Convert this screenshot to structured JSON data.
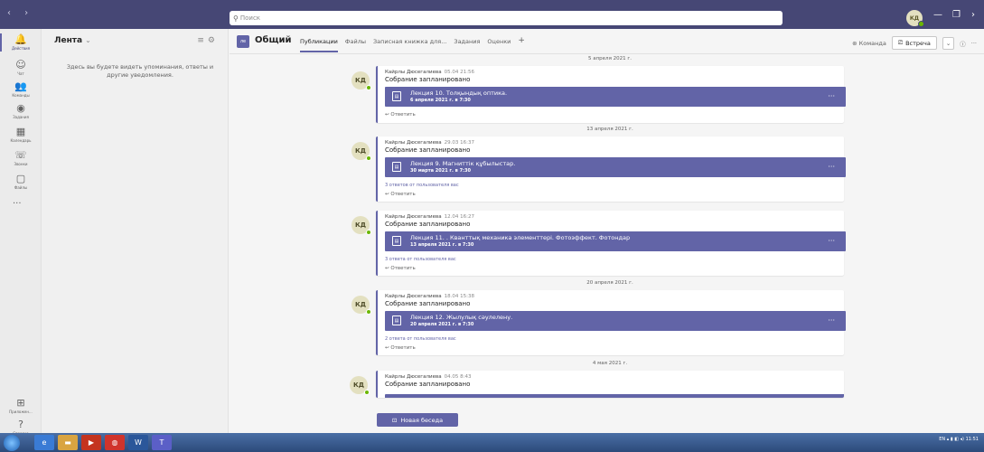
{
  "titlebar": {
    "nav_arrows": "‹ ›",
    "search_placeholder": "Поиск",
    "avatar_initials": "КД"
  },
  "rail": {
    "items": [
      {
        "label": "Действия",
        "icon": "bell-icon",
        "glyph": "🔔"
      },
      {
        "label": "Чат",
        "icon": "chat-icon",
        "glyph": "☺"
      },
      {
        "label": "Команды",
        "icon": "teams-icon",
        "glyph": "👥"
      },
      {
        "label": "Задания",
        "icon": "assignments-icon",
        "glyph": "◉"
      },
      {
        "label": "Календарь",
        "icon": "calendar-icon",
        "glyph": "▦"
      },
      {
        "label": "Звонки",
        "icon": "phone-icon",
        "glyph": "☏"
      },
      {
        "label": "Файлы",
        "icon": "files-icon",
        "glyph": "▢"
      }
    ],
    "more": "···",
    "bottom": [
      {
        "label": "Приложен...",
        "icon": "apps-icon",
        "glyph": "⊞"
      },
      {
        "label": "Справка",
        "icon": "help-icon",
        "glyph": "?"
      }
    ]
  },
  "feed": {
    "title": "Лента",
    "empty_text": "Здесь вы будете видеть упоминания, ответы и другие уведомления."
  },
  "channel": {
    "team_badge": "ле",
    "name": "Общий",
    "tabs": [
      "Публикации",
      "Файлы",
      "Записная книжка для...",
      "Задания",
      "Оценки"
    ],
    "team_btn": "Команда",
    "meet_btn": "Встреча"
  },
  "posts": [
    {
      "date": "5 апреля 2021 г.",
      "author": "Кайрлы Дюсегалиева",
      "time": "05.04 21:56",
      "text": "Собрание запланировано",
      "meeting_title": "Лекция 10. Толқындық оптика.",
      "meeting_date": "6 апреля 2021 г. в 7:30",
      "replies": "",
      "reply": "Ответить"
    },
    {
      "date": "13 апреля 2021 г.",
      "author": "Кайрлы Дюсегалиева",
      "time": "29.03 16:37",
      "text": "Собрание запланировано",
      "meeting_title": "Лекция 9. Магниттік құбылыстар.",
      "meeting_date": "30 марта 2021 г. в 7:30",
      "replies": "3 ответов от пользователя вас",
      "reply": "Ответить"
    },
    {
      "date": "",
      "author": "Кайрлы Дюсегалиева",
      "time": "12.04 16:27",
      "text": "Собрание запланировано",
      "meeting_title": "Лекция 11. . Кванттық механика элементтері. Фотоэффект. Фотондар",
      "meeting_date": "13 апреля 2021 г. в 7:30",
      "replies": "3 ответа от пользователя вас",
      "reply": "Ответить"
    },
    {
      "date": "20 апреля 2021 г.",
      "author": "Кайрлы Дюсегалиева",
      "time": "18.04 15:38",
      "text": "Собрание запланировано",
      "meeting_title": "Лекция 12. Жылулық сәулелену.",
      "meeting_date": "20 апреля 2021 г. в 7:30",
      "replies": "2 ответа от пользователя вас",
      "reply": "Ответить"
    },
    {
      "date": "4 мая 2021 г.",
      "author": "Кайрлы Дюсегалиева",
      "time": "04.05 8:43",
      "text": "Собрание запланировано",
      "meeting_title": "",
      "meeting_date": "",
      "replies": "",
      "reply": ""
    }
  ],
  "new_conversation": "Новая беседа",
  "taskbar": {
    "lang": "EN",
    "clock": "11:51"
  },
  "colors": {
    "accent": "#6264a7",
    "titlebar": "#464775",
    "presence": "#6bb700"
  }
}
